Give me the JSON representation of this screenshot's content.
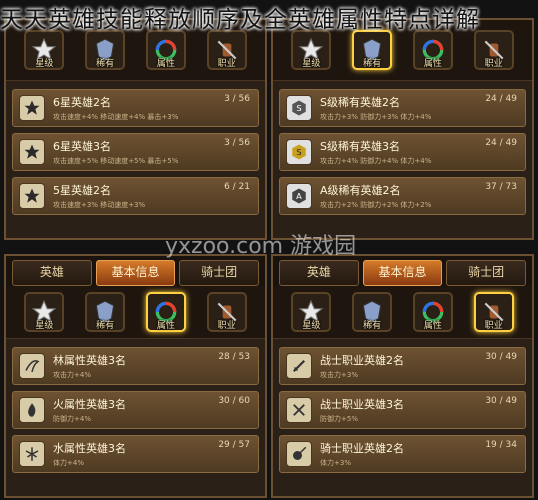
{
  "title": "天天英雄技能释放顺序及全英雄属性特点详解",
  "watermark": "yxzoo.com 游戏园",
  "panels": [
    {
      "tabs": [],
      "icons": [
        {
          "label": "星级",
          "icon": "star-icon",
          "selected": true
        },
        {
          "label": "稀有",
          "icon": "badge-icon",
          "selected": false
        },
        {
          "label": "属性",
          "icon": "element-ring-icon",
          "selected": false
        },
        {
          "label": "职业",
          "icon": "warrior-icon",
          "selected": false
        }
      ],
      "rows": [
        {
          "icon": "star-6-icon",
          "glyph": "6",
          "name": "6星英雄2名",
          "count": "3 / 56",
          "sub": "攻击速度+4% 移动速度+4% 暴击+3%"
        },
        {
          "icon": "star-6-icon",
          "glyph": "6",
          "name": "6星英雄3名",
          "count": "3 / 56",
          "sub": "攻击速度+5% 移动速度+5% 暴击+5%"
        },
        {
          "icon": "star-5-icon",
          "glyph": "5",
          "name": "5星英雄2名",
          "count": "6 / 21",
          "sub": "攻击速度+3% 移动速度+3%"
        }
      ]
    },
    {
      "tabs": [],
      "icons": [
        {
          "label": "星级",
          "icon": "star-icon",
          "selected": false
        },
        {
          "label": "稀有",
          "icon": "badge-icon",
          "selected": true
        },
        {
          "label": "属性",
          "icon": "element-ring-icon",
          "selected": false
        },
        {
          "label": "职业",
          "icon": "warrior-icon",
          "selected": false
        }
      ],
      "rows": [
        {
          "icon": "rank-s-icon",
          "glyph": "S",
          "name": "S级稀有英雄2名",
          "count": "24 / 49",
          "sub": "攻击力+3% 防御力+3% 体力+4%"
        },
        {
          "icon": "rank-s-gold-icon",
          "glyph": "S",
          "name": "S级稀有英雄3名",
          "count": "24 / 49",
          "sub": "攻击力+4% 防御力+4% 体力+4%"
        },
        {
          "icon": "rank-a-icon",
          "glyph": "A",
          "name": "A级稀有英雄2名",
          "count": "37 / 73",
          "sub": "攻击力+2% 防御力+2% 体力+2%"
        }
      ]
    },
    {
      "tabs": [
        {
          "label": "英雄",
          "active": false
        },
        {
          "label": "基本信息",
          "active": true
        },
        {
          "label": "骑士团",
          "active": false
        }
      ],
      "icons": [
        {
          "label": "星级",
          "icon": "star-icon",
          "selected": false
        },
        {
          "label": "稀有",
          "icon": "badge-icon",
          "selected": false
        },
        {
          "label": "属性",
          "icon": "element-ring-icon",
          "selected": true
        },
        {
          "label": "职业",
          "icon": "warrior-icon",
          "selected": false
        }
      ],
      "rows": [
        {
          "icon": "wood-element-icon",
          "glyph": "木",
          "name": "林属性英雄3名",
          "count": "28 / 53",
          "sub": "攻击力+4%"
        },
        {
          "icon": "fire-element-icon",
          "glyph": "火",
          "name": "火属性英雄3名",
          "count": "30 / 60",
          "sub": "防御力+4%"
        },
        {
          "icon": "water-element-icon",
          "glyph": "水",
          "name": "水属性英雄3名",
          "count": "29 / 57",
          "sub": "体力+4%"
        }
      ]
    },
    {
      "tabs": [
        {
          "label": "英雄",
          "active": false
        },
        {
          "label": "基本信息",
          "active": true
        },
        {
          "label": "骑士团",
          "active": false
        }
      ],
      "icons": [
        {
          "label": "星级",
          "icon": "star-icon",
          "selected": false
        },
        {
          "label": "稀有",
          "icon": "badge-icon",
          "selected": false
        },
        {
          "label": "属性",
          "icon": "element-ring-icon",
          "selected": false
        },
        {
          "label": "职业",
          "icon": "warrior-icon",
          "selected": true
        }
      ],
      "rows": [
        {
          "icon": "sword-icon",
          "glyph": "剑",
          "name": "战士职业英雄2名",
          "count": "30 / 49",
          "sub": "攻击力+3%"
        },
        {
          "icon": "crossed-swords-icon",
          "glyph": "剑",
          "name": "战士职业英雄3名",
          "count": "30 / 49",
          "sub": "防御力+5%"
        },
        {
          "icon": "lance-icon",
          "glyph": "枪",
          "name": "骑士职业英雄2名",
          "count": "19 / 34",
          "sub": "体力+3%"
        }
      ]
    }
  ]
}
